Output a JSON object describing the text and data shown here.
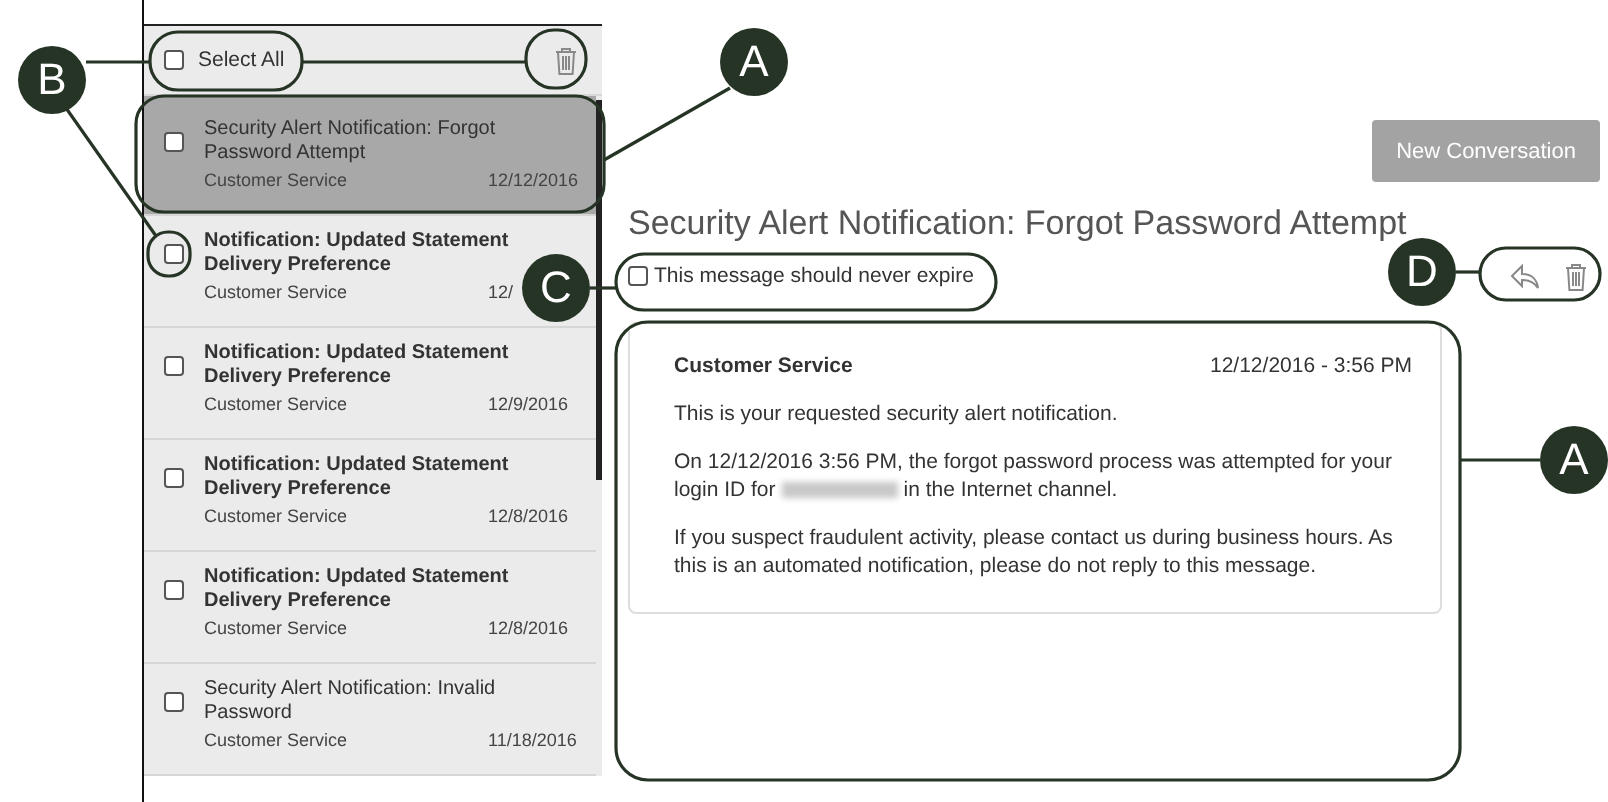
{
  "sidebar": {
    "select_all": {
      "label": "Select All",
      "checked": false
    },
    "messages": [
      {
        "title": "Security Alert Notification: Forgot Password Attempt",
        "sender": "Customer Service",
        "date": "12/12/2016",
        "selected": true,
        "unread": false,
        "checked": false
      },
      {
        "title": "Notification: Updated Statement Delivery Preference",
        "sender": "Customer Service",
        "date": "12/",
        "selected": false,
        "unread": true,
        "checked": false
      },
      {
        "title": "Notification: Updated Statement Delivery Preference",
        "sender": "Customer Service",
        "date": "12/9/2016",
        "selected": false,
        "unread": true,
        "checked": false
      },
      {
        "title": "Notification: Updated Statement Delivery Preference",
        "sender": "Customer Service",
        "date": "12/8/2016",
        "selected": false,
        "unread": true,
        "checked": false
      },
      {
        "title": "Notification: Updated Statement Delivery Preference",
        "sender": "Customer Service",
        "date": "12/8/2016",
        "selected": false,
        "unread": true,
        "checked": false
      },
      {
        "title": "Security Alert Notification: Invalid Password",
        "sender": "Customer Service",
        "date": "11/18/2016",
        "selected": false,
        "unread": false,
        "checked": false
      }
    ]
  },
  "new_button": "New Conversation",
  "message": {
    "subject": "Security Alert Notification: Forgot Password Attempt",
    "never_expire": {
      "label": "This message should never expire",
      "checked": false
    },
    "sender": "Customer Service",
    "timestamp": "12/12/2016 - 3:56 PM",
    "paragraphs": [
      {
        "text": "This is your requested security alert notification.",
        "redacted": false
      },
      {
        "text": "On 12/12/2016 3:56 PM, the forgot password process was attempted for your login ID for",
        "redacted": true,
        "text_after": "in the Internet channel."
      },
      {
        "text": "If you suspect fraudulent activity, please contact us during business hours. As this is an automated notification, please do not reply to this message.",
        "redacted": false
      }
    ]
  },
  "callouts": [
    {
      "label": "B"
    },
    {
      "label": "A"
    },
    {
      "label": "C"
    },
    {
      "label": "D"
    },
    {
      "label": "A"
    }
  ]
}
